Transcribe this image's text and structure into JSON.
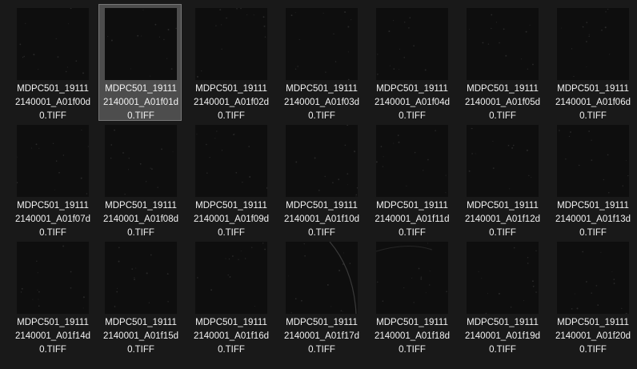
{
  "window": {
    "view": "large-icons"
  },
  "files": [
    {
      "lines": [
        "MDPC501_19111",
        "2140001_A01f00d",
        "0.TIFF"
      ],
      "selected": false
    },
    {
      "lines": [
        "MDPC501_19111",
        "2140001_A01f01d",
        "0.TIFF"
      ],
      "selected": true
    },
    {
      "lines": [
        "MDPC501_19111",
        "2140001_A01f02d",
        "0.TIFF"
      ],
      "selected": false
    },
    {
      "lines": [
        "MDPC501_19111",
        "2140001_A01f03d",
        "0.TIFF"
      ],
      "selected": false
    },
    {
      "lines": [
        "MDPC501_19111",
        "2140001_A01f04d",
        "0.TIFF"
      ],
      "selected": false
    },
    {
      "lines": [
        "MDPC501_19111",
        "2140001_A01f05d",
        "0.TIFF"
      ],
      "selected": false
    },
    {
      "lines": [
        "MDPC501_19111",
        "2140001_A01f06d",
        "0.TIFF"
      ],
      "selected": false
    },
    {
      "lines": [
        "MDPC501_19111",
        "2140001_A01f07d",
        "0.TIFF"
      ],
      "selected": false
    },
    {
      "lines": [
        "MDPC501_19111",
        "2140001_A01f08d",
        "0.TIFF"
      ],
      "selected": false
    },
    {
      "lines": [
        "MDPC501_19111",
        "2140001_A01f09d",
        "0.TIFF"
      ],
      "selected": false
    },
    {
      "lines": [
        "MDPC501_19111",
        "2140001_A01f10d",
        "0.TIFF"
      ],
      "selected": false
    },
    {
      "lines": [
        "MDPC501_19111",
        "2140001_A01f11d",
        "0.TIFF"
      ],
      "selected": false
    },
    {
      "lines": [
        "MDPC501_19111",
        "2140001_A01f12d",
        "0.TIFF"
      ],
      "selected": false
    },
    {
      "lines": [
        "MDPC501_19111",
        "2140001_A01f13d",
        "0.TIFF"
      ],
      "selected": false
    },
    {
      "lines": [
        "MDPC501_19111",
        "2140001_A01f14d",
        "0.TIFF"
      ],
      "selected": false
    },
    {
      "lines": [
        "MDPC501_19111",
        "2140001_A01f15d",
        "0.TIFF"
      ],
      "selected": false
    },
    {
      "lines": [
        "MDPC501_19111",
        "2140001_A01f16d",
        "0.TIFF"
      ],
      "selected": false
    },
    {
      "lines": [
        "MDPC501_19111",
        "2140001_A01f17d",
        "0.TIFF"
      ],
      "selected": false
    },
    {
      "lines": [
        "MDPC501_19111",
        "2140001_A01f18d",
        "0.TIFF"
      ],
      "selected": false
    },
    {
      "lines": [
        "MDPC501_19111",
        "2140001_A01f19d",
        "0.TIFF"
      ],
      "selected": false
    },
    {
      "lines": [
        "MDPC501_19111",
        "2140001_A01f20d",
        "0.TIFF"
      ],
      "selected": false
    }
  ],
  "colors": {
    "background": "#191919",
    "thumbnail": "#0e0e0e",
    "selection": "#4d4d4d",
    "selection_border": "#777777",
    "text": "#f2f2f2"
  }
}
